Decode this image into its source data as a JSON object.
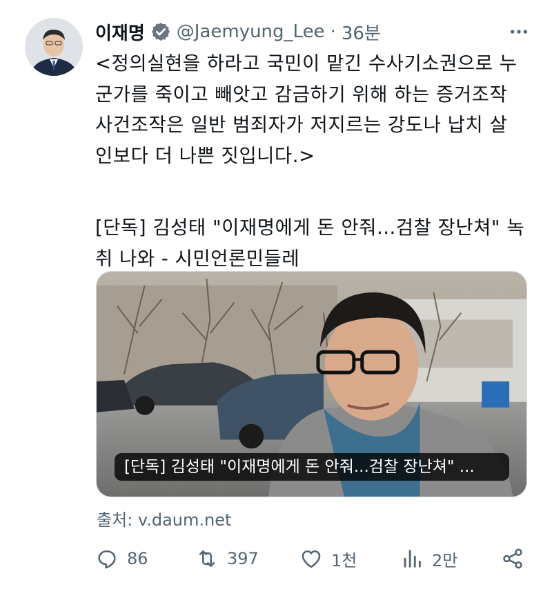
{
  "author": {
    "name": "이재명",
    "handle": "@Jaemyung_Lee",
    "separator": "·",
    "time": "36분"
  },
  "icons": {
    "avatar": "profile-photo",
    "verified": "verified-badge-icon",
    "more": "more-horizontal-icon",
    "reply": "reply-icon",
    "retweet": "retweet-icon",
    "like": "heart-icon",
    "views": "analytics-icon",
    "share": "share-icon"
  },
  "tweet": {
    "lines": [
      "<정의실현을 하라고 국민이 맡긴 수사기소권으로 누",
      "군가를 죽이고 빼앗고 감금하기 위해 하는 증거조작",
      "사건조작은 일반 범죄자가 저지르는 강도나 납치 살",
      "인보다 더 나쁜 짓입니다.>"
    ],
    "link_lines": [
      "[단독] 김성태 \"이재명에게 돈 안줘...검찰 장난쳐\" 녹",
      "취 나와 - 시민언론민들레"
    ]
  },
  "card": {
    "caption": "[단독] 김성태 \"이재명에게 돈 안줘...검찰 장난쳐\" ...",
    "source": "출처: v.daum.net"
  },
  "stats": {
    "replies": "86",
    "retweets": "397",
    "likes": "1천",
    "views": "2만"
  },
  "colors": {
    "text": "#0f1419",
    "secondary": "#536471",
    "verified": "#1d9bf0"
  }
}
